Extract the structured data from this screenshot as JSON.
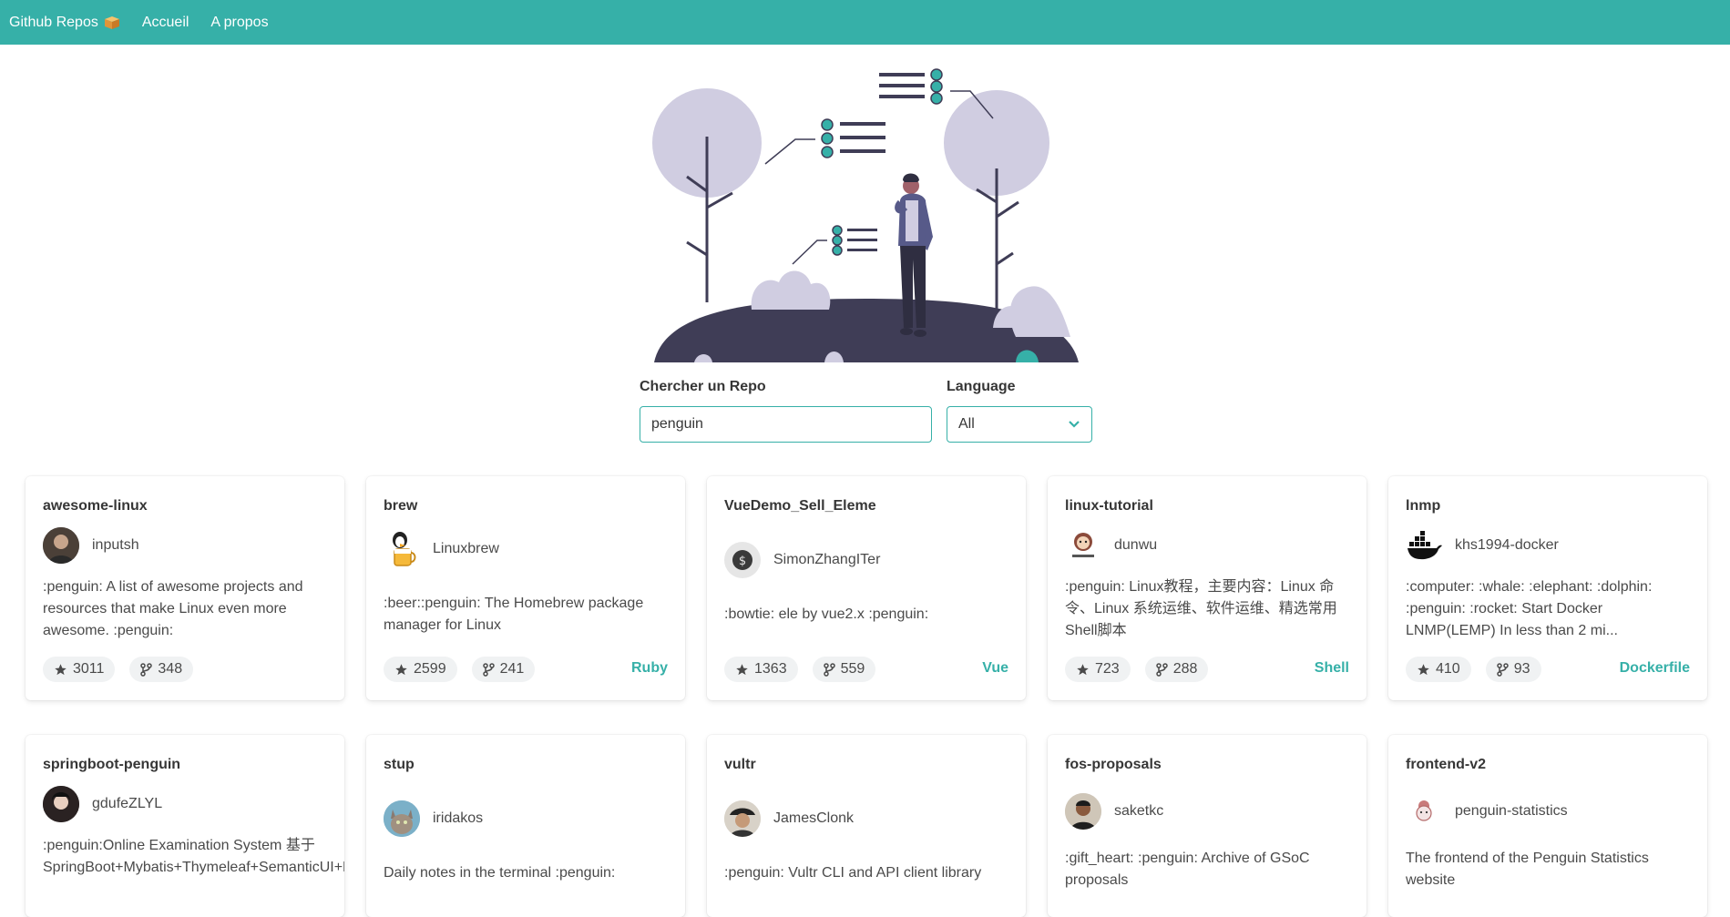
{
  "nav": {
    "brand": "Github Repos",
    "brand_icon": "package-box-icon",
    "items": [
      "Accueil",
      "A propos"
    ]
  },
  "search": {
    "label": "Chercher un Repo",
    "value": "penguin"
  },
  "language": {
    "label": "Language",
    "selected": "All"
  },
  "colors": {
    "accent": "#36b0a8",
    "hero_dark": "#3f3d56",
    "hero_tree": "#d0cde1"
  },
  "repos": [
    {
      "title": "awesome-linux",
      "owner": "inputsh",
      "description": ":penguin: A list of awesome projects and resources that make Linux even more awesome. :penguin:",
      "stars": "3011",
      "forks": "348",
      "language": ""
    },
    {
      "title": "brew",
      "owner": "Linuxbrew",
      "description": ":beer::penguin: The Homebrew package manager for Linux",
      "stars": "2599",
      "forks": "241",
      "language": "Ruby"
    },
    {
      "title": "VueDemo_Sell_Eleme",
      "owner": "SimonZhangITer",
      "description": ":bowtie: ele by vue2.x :penguin:",
      "stars": "1363",
      "forks": "559",
      "language": "Vue"
    },
    {
      "title": "linux-tutorial",
      "owner": "dunwu",
      "description": ":penguin: Linux教程，主要内容：Linux 命令、Linux 系统运维、软件运维、精选常用Shell脚本",
      "stars": "723",
      "forks": "288",
      "language": "Shell"
    },
    {
      "title": "lnmp",
      "owner": "khs1994-docker",
      "description": ":computer: :whale: :elephant: :dolphin: :penguin: :rocket: Start Docker LNMP(LEMP) In less than 2 mi...",
      "stars": "410",
      "forks": "93",
      "language": "Dockerfile"
    },
    {
      "title": "springboot-penguin",
      "owner": "gdufeZLYL",
      "description": ":penguin:Online Examination System 基于SpringBoot+Mybatis+Thymeleaf+SemanticUI+Bo",
      "stars": "",
      "forks": "",
      "language": ""
    },
    {
      "title": "stup",
      "owner": "iridakos",
      "description": "Daily notes in the terminal :penguin:",
      "stars": "",
      "forks": "",
      "language": ""
    },
    {
      "title": "vultr",
      "owner": "JamesClonk",
      "description": ":penguin: Vultr CLI and API client library",
      "stars": "",
      "forks": "",
      "language": ""
    },
    {
      "title": "fos-proposals",
      "owner": "saketkc",
      "description": ":gift_heart: :penguin: Archive of GSoC proposals",
      "stars": "",
      "forks": "",
      "language": ""
    },
    {
      "title": "frontend-v2",
      "owner": "penguin-statistics",
      "description": "The frontend of the Penguin Statistics website",
      "stars": "",
      "forks": "",
      "language": ""
    }
  ]
}
